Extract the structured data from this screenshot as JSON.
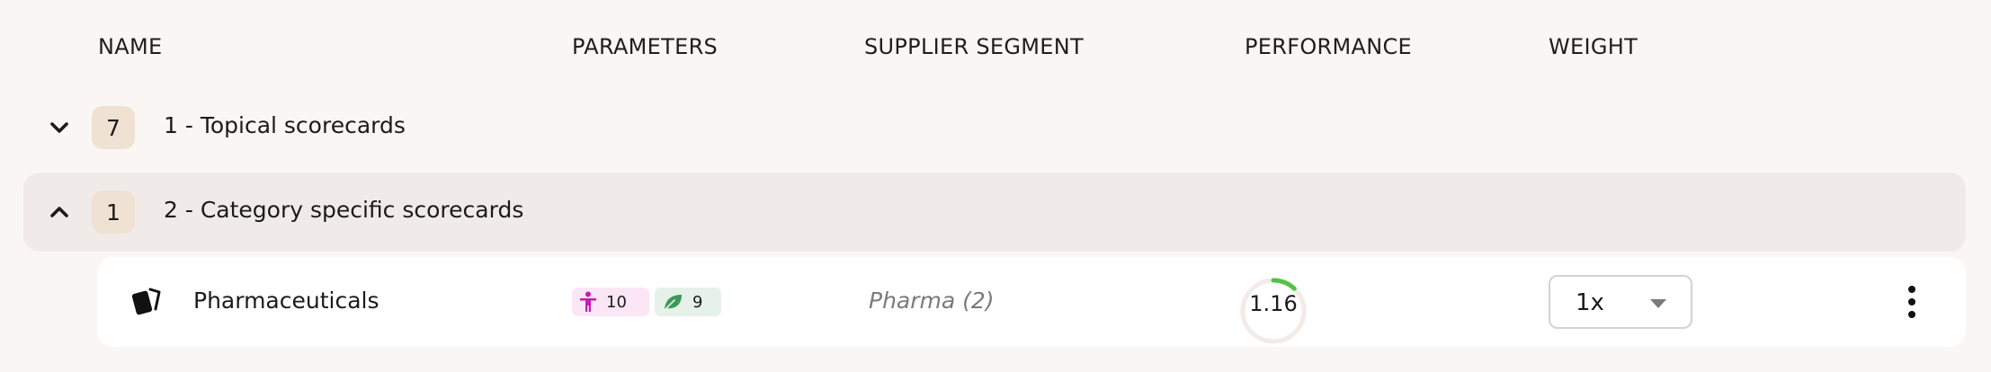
{
  "columns": {
    "name": "NAME",
    "parameters": "PARAMETERS",
    "supplier_segment": "SUPPLIER SEGMENT",
    "performance": "PERFORMANCE",
    "weight": "WEIGHT"
  },
  "groups": [
    {
      "count": "7",
      "title": "1 - Topical scorecards",
      "expanded": false,
      "icon": "chevron-down-icon"
    },
    {
      "count": "1",
      "title": "2 - Category specific scorecards",
      "expanded": true,
      "icon": "chevron-up-icon"
    }
  ],
  "item": {
    "icon": "cards-icon",
    "name": "Pharmaceuticals",
    "parameters": [
      {
        "icon": "person-icon",
        "count": "10",
        "color": "#c41eb5",
        "bg": "#fbe6f6"
      },
      {
        "icon": "leaf-icon",
        "count": "9",
        "color": "#3c9a5a",
        "bg": "#e5f1e9"
      }
    ],
    "segment": "Pharma (2)",
    "performance": {
      "value": "1.16",
      "fraction": 0.12,
      "color": "#55c14a"
    },
    "weight": "1x",
    "more_icon": "more-vertical-icon"
  },
  "colors": {
    "background": "#faf6f4",
    "active_group": "#f0ebe9",
    "badge": "#efe2d2"
  }
}
